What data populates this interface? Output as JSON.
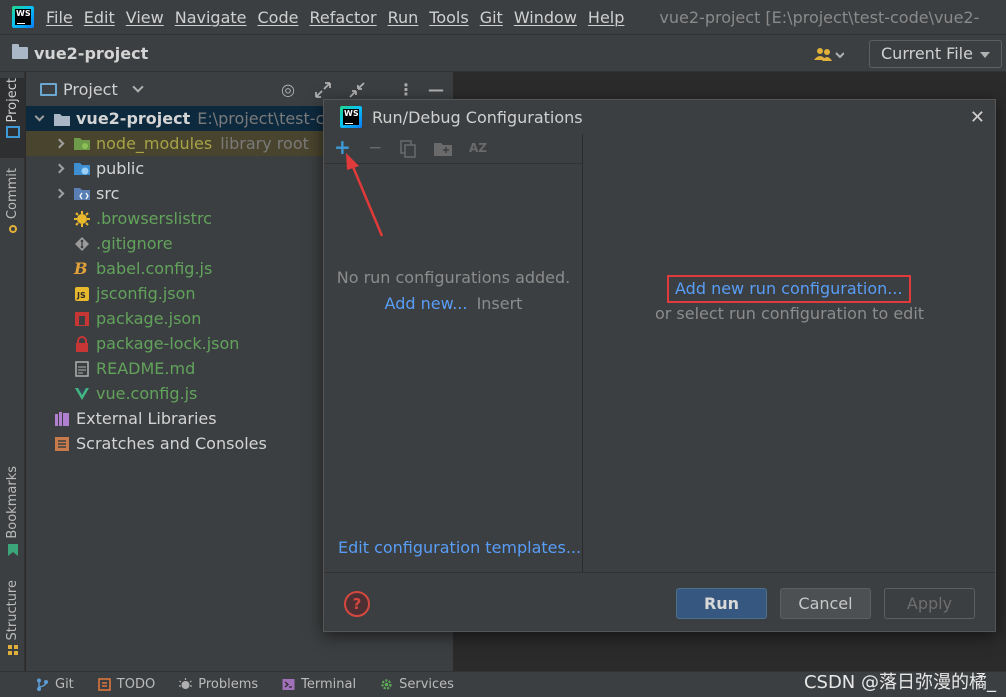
{
  "menubar": {
    "items": [
      "File",
      "Edit",
      "View",
      "Navigate",
      "Code",
      "Refactor",
      "Run",
      "Tools",
      "Git",
      "Window",
      "Help"
    ],
    "window_title": "vue2-project [E:\\project\\test-code\\vue2-"
  },
  "toolbar": {
    "project_name": "vue2-project",
    "run_config_selector": "Current File"
  },
  "left_strip": {
    "tabs": [
      "Project",
      "Commit",
      "Bookmarks",
      "Structure"
    ]
  },
  "project_panel": {
    "title": "Project",
    "tree": [
      {
        "name": "vue2-project",
        "hint": "E:\\project\\test-co"
      },
      {
        "name": "node_modules",
        "hint": "library root"
      },
      {
        "name": "public",
        "hint": ""
      },
      {
        "name": "src",
        "hint": ""
      },
      {
        "name": ".browserslistrc",
        "hint": ""
      },
      {
        "name": ".gitignore",
        "hint": ""
      },
      {
        "name": "babel.config.js",
        "hint": ""
      },
      {
        "name": "jsconfig.json",
        "hint": ""
      },
      {
        "name": "package.json",
        "hint": ""
      },
      {
        "name": "package-lock.json",
        "hint": ""
      },
      {
        "name": "README.md",
        "hint": ""
      },
      {
        "name": "vue.config.js",
        "hint": ""
      },
      {
        "name": "External Libraries",
        "hint": ""
      },
      {
        "name": "Scratches and Consoles",
        "hint": ""
      }
    ]
  },
  "dialog": {
    "title": "Run/Debug Configurations",
    "empty_message": "No run configurations added.",
    "add_new_link": "Add new...",
    "add_new_shortcut": "Insert",
    "edit_templates_link": "Edit configuration templates...",
    "add_run_config_link": "Add new run configuration...",
    "or_select_text": "or select run configuration to edit",
    "buttons": {
      "run": "Run",
      "cancel": "Cancel",
      "apply": "Apply"
    },
    "help_symbol": "?"
  },
  "bottom_bar": {
    "items": [
      "Git",
      "TODO",
      "Problems",
      "Terminal",
      "Services"
    ]
  },
  "watermark": "CSDN @落日弥漫的橘_",
  "colors": {
    "accent_link": "#589df6",
    "annotation_red": "#e03a3a",
    "run_button": "#365880"
  }
}
